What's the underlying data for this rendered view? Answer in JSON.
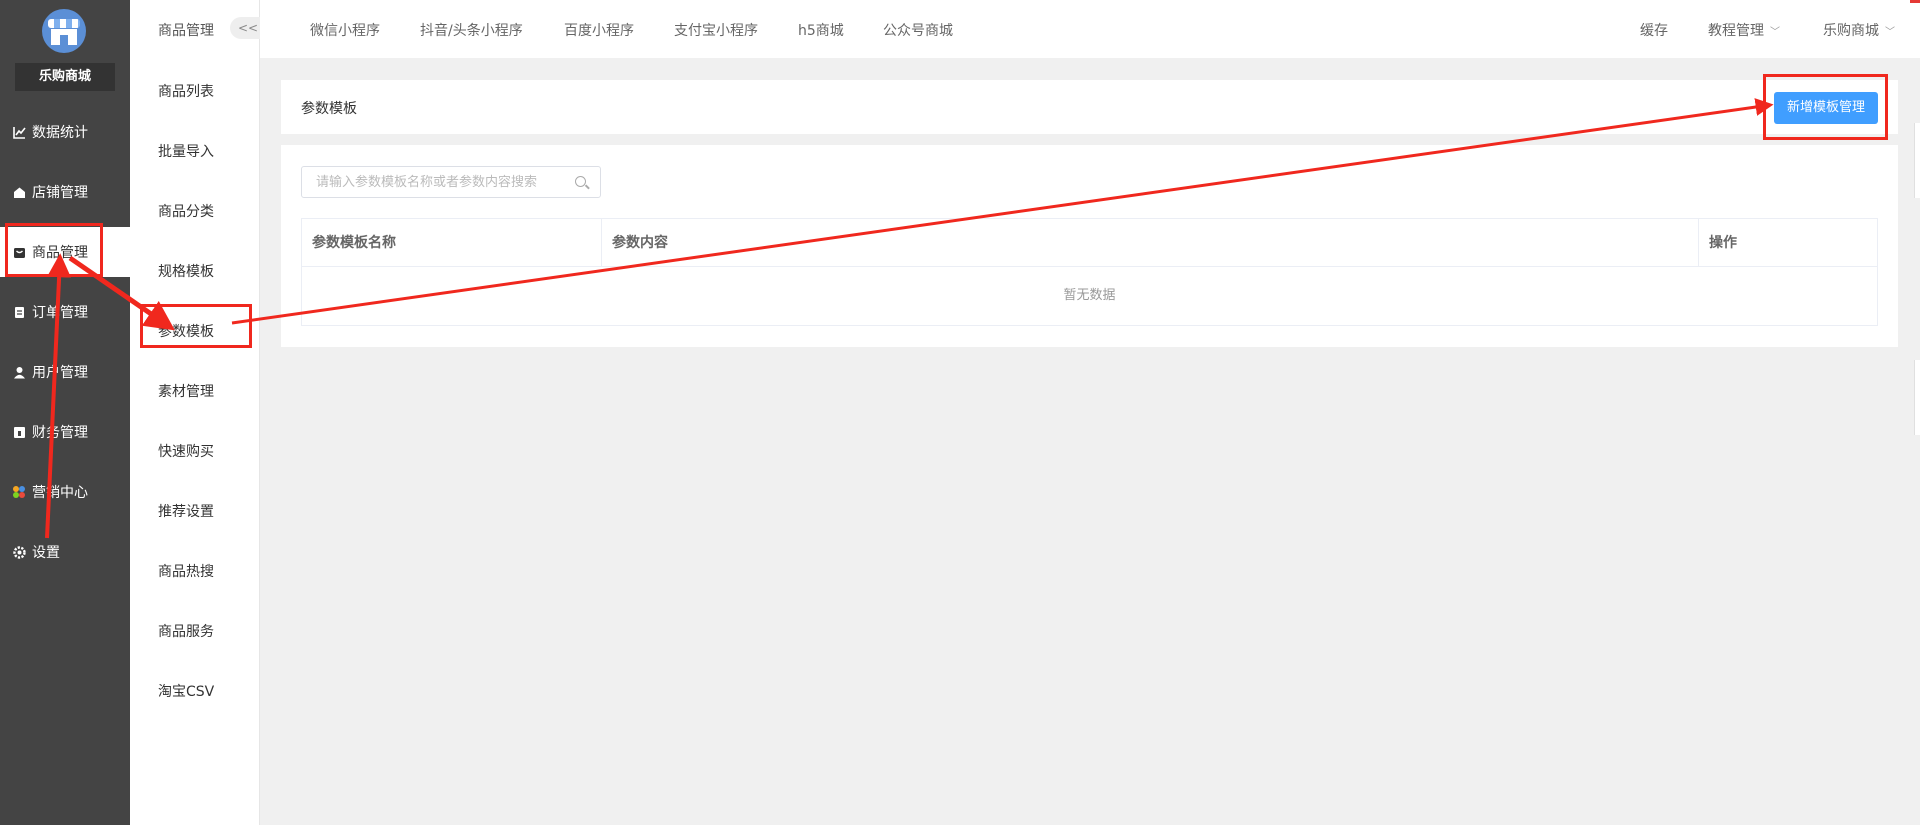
{
  "sidebar": {
    "shop_name": "乐购商城",
    "items": [
      {
        "label": "数据统计",
        "icon": "chart-line-icon"
      },
      {
        "label": "店铺管理",
        "icon": "store-icon"
      },
      {
        "label": "商品管理",
        "icon": "bag-icon"
      },
      {
        "label": "订单管理",
        "icon": "clipboard-icon"
      },
      {
        "label": "用户管理",
        "icon": "user-icon"
      },
      {
        "label": "财务管理",
        "icon": "finance-icon"
      },
      {
        "label": "营销中心",
        "icon": "marketing-icon"
      },
      {
        "label": "设置",
        "icon": "gear-icon"
      }
    ],
    "active_index": 2
  },
  "subnav": {
    "title": "商品管理",
    "collapse_label": "<<",
    "items": [
      "商品列表",
      "批量导入",
      "商品分类",
      "规格模板",
      "参数模板",
      "素材管理",
      "快速购买",
      "推荐设置",
      "商品热搜",
      "商品服务",
      "淘宝CSV"
    ],
    "active_index": 4
  },
  "topbar": {
    "tabs": [
      "微信小程序",
      "抖音/头条小程序",
      "百度小程序",
      "支付宝小程序",
      "h5商城",
      "公众号商城"
    ],
    "right": {
      "cache": "缓存",
      "tutorial": "教程管理",
      "shop": "乐购商城"
    }
  },
  "main": {
    "title": "参数模板",
    "add_button": "新增模板管理",
    "search_placeholder": "请输入参数模板名称或者参数内容搜索",
    "table": {
      "headers": [
        "参数模板名称",
        "参数内容",
        "操作"
      ],
      "empty_text": "暂无数据"
    }
  },
  "colors": {
    "sidebar_bg": "#444444",
    "primary": "#409eff",
    "annotation": "#f0281e"
  }
}
